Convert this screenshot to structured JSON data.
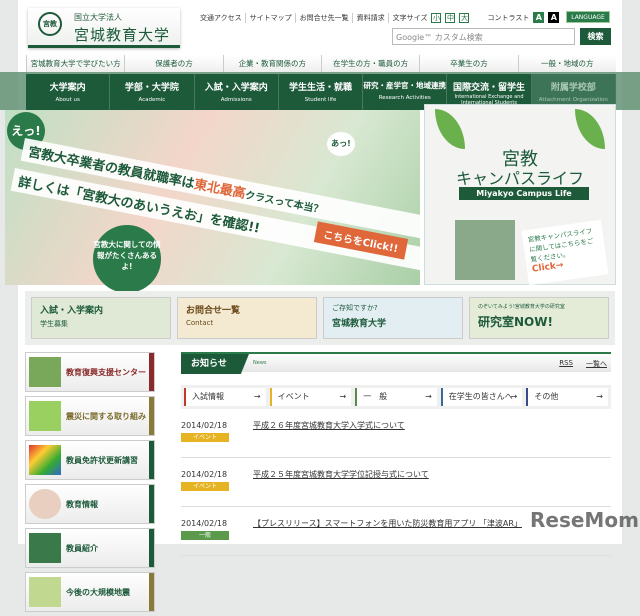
{
  "header": {
    "seal": "宮教",
    "sub": "国立大学法人",
    "name": "宮城教育大学",
    "util": [
      "交通アクセス",
      "サイトマップ",
      "お問合せ先一覧",
      "資料請求"
    ],
    "fontsize_label": "文字サイズ",
    "fontsizes": [
      "小",
      "中",
      "大"
    ],
    "contrast_label": "コントラスト",
    "contrast": [
      "A",
      "A"
    ],
    "language": "LANGUAGE",
    "search_placeholder": "Google™ カスタム検索",
    "search_button": "検索"
  },
  "audience": [
    "宮城教育大学で学びたい方",
    "保護者の方",
    "企業・教育関係の方",
    "在学生の方・職員の方",
    "卒業生の方",
    "一般・地域の方"
  ],
  "nav": [
    {
      "ja": "大学案内",
      "en": "About us"
    },
    {
      "ja": "学部・大学院",
      "en": "Academic"
    },
    {
      "ja": "入試・入学案内",
      "en": "Admissions"
    },
    {
      "ja": "学生生活・就職",
      "en": "Student life"
    },
    {
      "ja": "研究・産学官・地域連携",
      "en": "Research Activities"
    },
    {
      "ja": "国際交流・留学生",
      "en": "International Exchange and International Students"
    },
    {
      "ja": "附属学校部",
      "en": "Attachment Organization"
    }
  ],
  "hero": {
    "exclaim": "えっ!",
    "line1a": "宮教大卒業者の教員就職率は",
    "line1b": "東北最高",
    "line1c": "クラスって本当？",
    "line2": "詳しくは「宮教大のあいうえお」を確認!!",
    "click": "こちらをClick!!",
    "bubble": "宮教大に関しての情報がたくさんあるよ!",
    "char_say": "あっ!"
  },
  "campus": {
    "t1": "宮教",
    "t2": "キャンパスライフ",
    "en": "Miyakyo Campus Life",
    "note": "宮教キャンパスライフに関してはこちらをご覧ください。",
    "click": "Click→"
  },
  "banners": [
    {
      "title": "入試・入学案内",
      "sub": "学生募集"
    },
    {
      "title": "お問合せ一覧",
      "sub": "Contact"
    },
    {
      "title": "ご存知ですか?",
      "sub": "宮城教育大学"
    },
    {
      "title": "研究室NOW!",
      "sub": "のぞいてみよう!宮城教育大学の研究室"
    }
  ],
  "sidebar": [
    "教育復興支援センター",
    "震災に関する取り組み",
    "教員免許状更新講習",
    "教育情報",
    "教員紹介",
    "今後の大規模地震"
  ],
  "news": {
    "title": "お知らせ",
    "en": "News",
    "rss": "RSS",
    "all": "一覧へ",
    "cats": [
      {
        "label": "入試情報",
        "color": "#c0392b"
      },
      {
        "label": "イベント",
        "color": "#e6b422"
      },
      {
        "label": "一　般",
        "color": "#5a8a4a"
      },
      {
        "label": "在学生の皆さんへ",
        "color": "#3a6a9a"
      },
      {
        "label": "その他",
        "color": "#3a4a8a"
      }
    ],
    "items": [
      {
        "date": "2014/02/18",
        "tag": "イベント",
        "tagcolor": "#e6b422",
        "title": "平成２６年度宮城教育大学入学式について"
      },
      {
        "date": "2014/02/18",
        "tag": "イベント",
        "tagcolor": "#e6b422",
        "title": "平成２５年度宮城教育大学学位記授与式について"
      },
      {
        "date": "2014/02/18",
        "tag": "一般",
        "tagcolor": "#5a9a4a",
        "title": "【プレスリリース】スマートフォンを用いた防災教育用アプリ 「津波AR」"
      }
    ]
  },
  "watermark": "ReseMom"
}
